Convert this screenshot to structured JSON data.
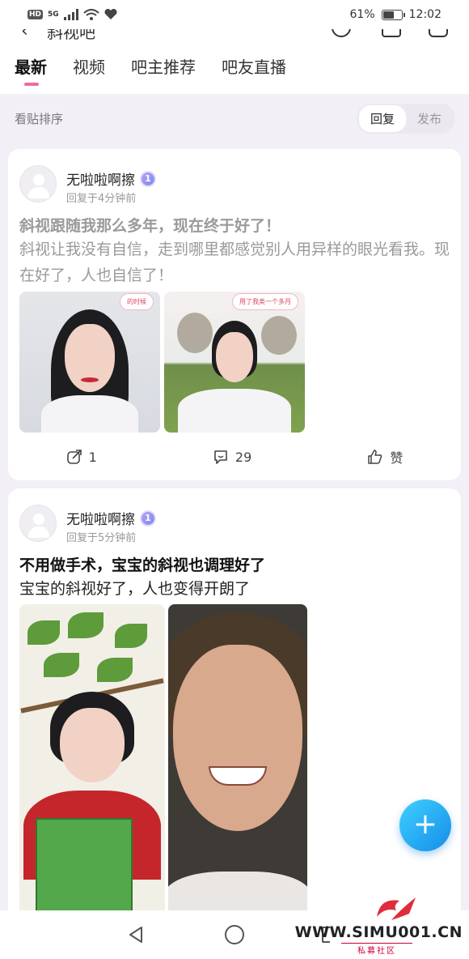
{
  "status_bar": {
    "hd": "HD",
    "network": "5G",
    "battery": "61%",
    "battery_level": 0.61,
    "time": "12:02"
  },
  "header": {
    "title": "斜视吧"
  },
  "tabs": [
    {
      "label": "最新",
      "active": true
    },
    {
      "label": "视频",
      "active": false
    },
    {
      "label": "吧主推荐",
      "active": false
    },
    {
      "label": "吧友直播",
      "active": false
    }
  ],
  "sort": {
    "label": "看贴排序",
    "options": [
      "回复",
      "发布"
    ],
    "selected": "回复"
  },
  "posts": [
    {
      "username": "无啦啦啊擦",
      "level": "1",
      "meta": "回复于4分钟前",
      "title": "斜视跟随我那么多年，现在终于好了！",
      "body": "斜视让我没有自信，走到哪里都感觉别人用异样的眼光看我。现在好了，人也自信了！",
      "image_captions": [
        "的时候",
        "用了我类一个多月"
      ],
      "share_count": "1",
      "comment_count": "29",
      "like_label": "赞"
    },
    {
      "username": "无啦啦啊擦",
      "level": "1",
      "meta": "回复于5分钟前",
      "title": "不用做手术，宝宝的斜视也调理好了",
      "body": "宝宝的斜视好了，人也变得开朗了"
    }
  ],
  "fab": {
    "symbol": "+"
  },
  "watermark": {
    "text": "WWW.SIMU001.CN",
    "sub": "私募社区"
  },
  "colors": {
    "accent": "#f06aa2",
    "fab": "#1ea1f0"
  }
}
